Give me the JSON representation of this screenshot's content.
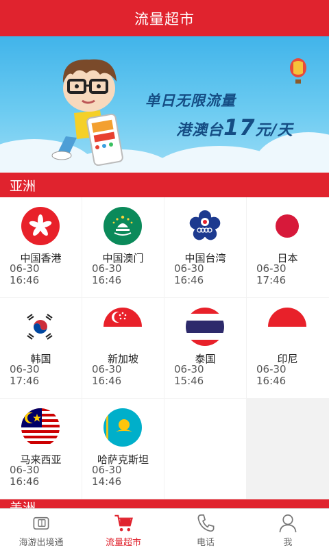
{
  "header": {
    "title": "流量超市"
  },
  "banner": {
    "line1": "单日无限流量",
    "line2_prefix": "港澳台",
    "line2_number": "17",
    "line2_suffix": "元/天"
  },
  "sections": [
    {
      "label": "亚洲"
    },
    {
      "label": "美洲"
    }
  ],
  "countries": [
    {
      "name": "中国香港",
      "date": "06-30",
      "time": "16:46",
      "flag": "hong-kong-flag-icon"
    },
    {
      "name": "中国澳门",
      "date": "06-30",
      "time": "16:46",
      "flag": "macau-flag-icon"
    },
    {
      "name": "中国台湾",
      "date": "06-30",
      "time": "16:46",
      "flag": "taiwan-flag-icon"
    },
    {
      "name": "日本",
      "date": "06-30",
      "time": "17:46",
      "flag": "japan-flag-icon"
    },
    {
      "name": "韩国",
      "date": "06-30",
      "time": "17:46",
      "flag": "korea-flag-icon"
    },
    {
      "name": "新加坡",
      "date": "06-30",
      "time": "16:46",
      "flag": "singapore-flag-icon"
    },
    {
      "name": "泰国",
      "date": "06-30",
      "time": "15:46",
      "flag": "thailand-flag-icon"
    },
    {
      "name": "印尼",
      "date": "06-30",
      "time": "16:46",
      "flag": "indonesia-flag-icon"
    },
    {
      "name": "马来西亚",
      "date": "06-30",
      "time": "16:46",
      "flag": "malaysia-flag-icon"
    },
    {
      "name": "哈萨克斯坦",
      "date": "06-30",
      "time": "14:46",
      "flag": "kazakhstan-flag-icon"
    }
  ],
  "tabs": [
    {
      "label": "海游出境通",
      "icon": "sim-card-icon",
      "active": false
    },
    {
      "label": "流量超市",
      "icon": "shopping-cart-icon",
      "active": true
    },
    {
      "label": "电话",
      "icon": "phone-icon",
      "active": false
    },
    {
      "label": "我",
      "icon": "person-icon",
      "active": false
    }
  ],
  "colors": {
    "brand_red": "#e0232e",
    "banner_text": "#154d84"
  }
}
